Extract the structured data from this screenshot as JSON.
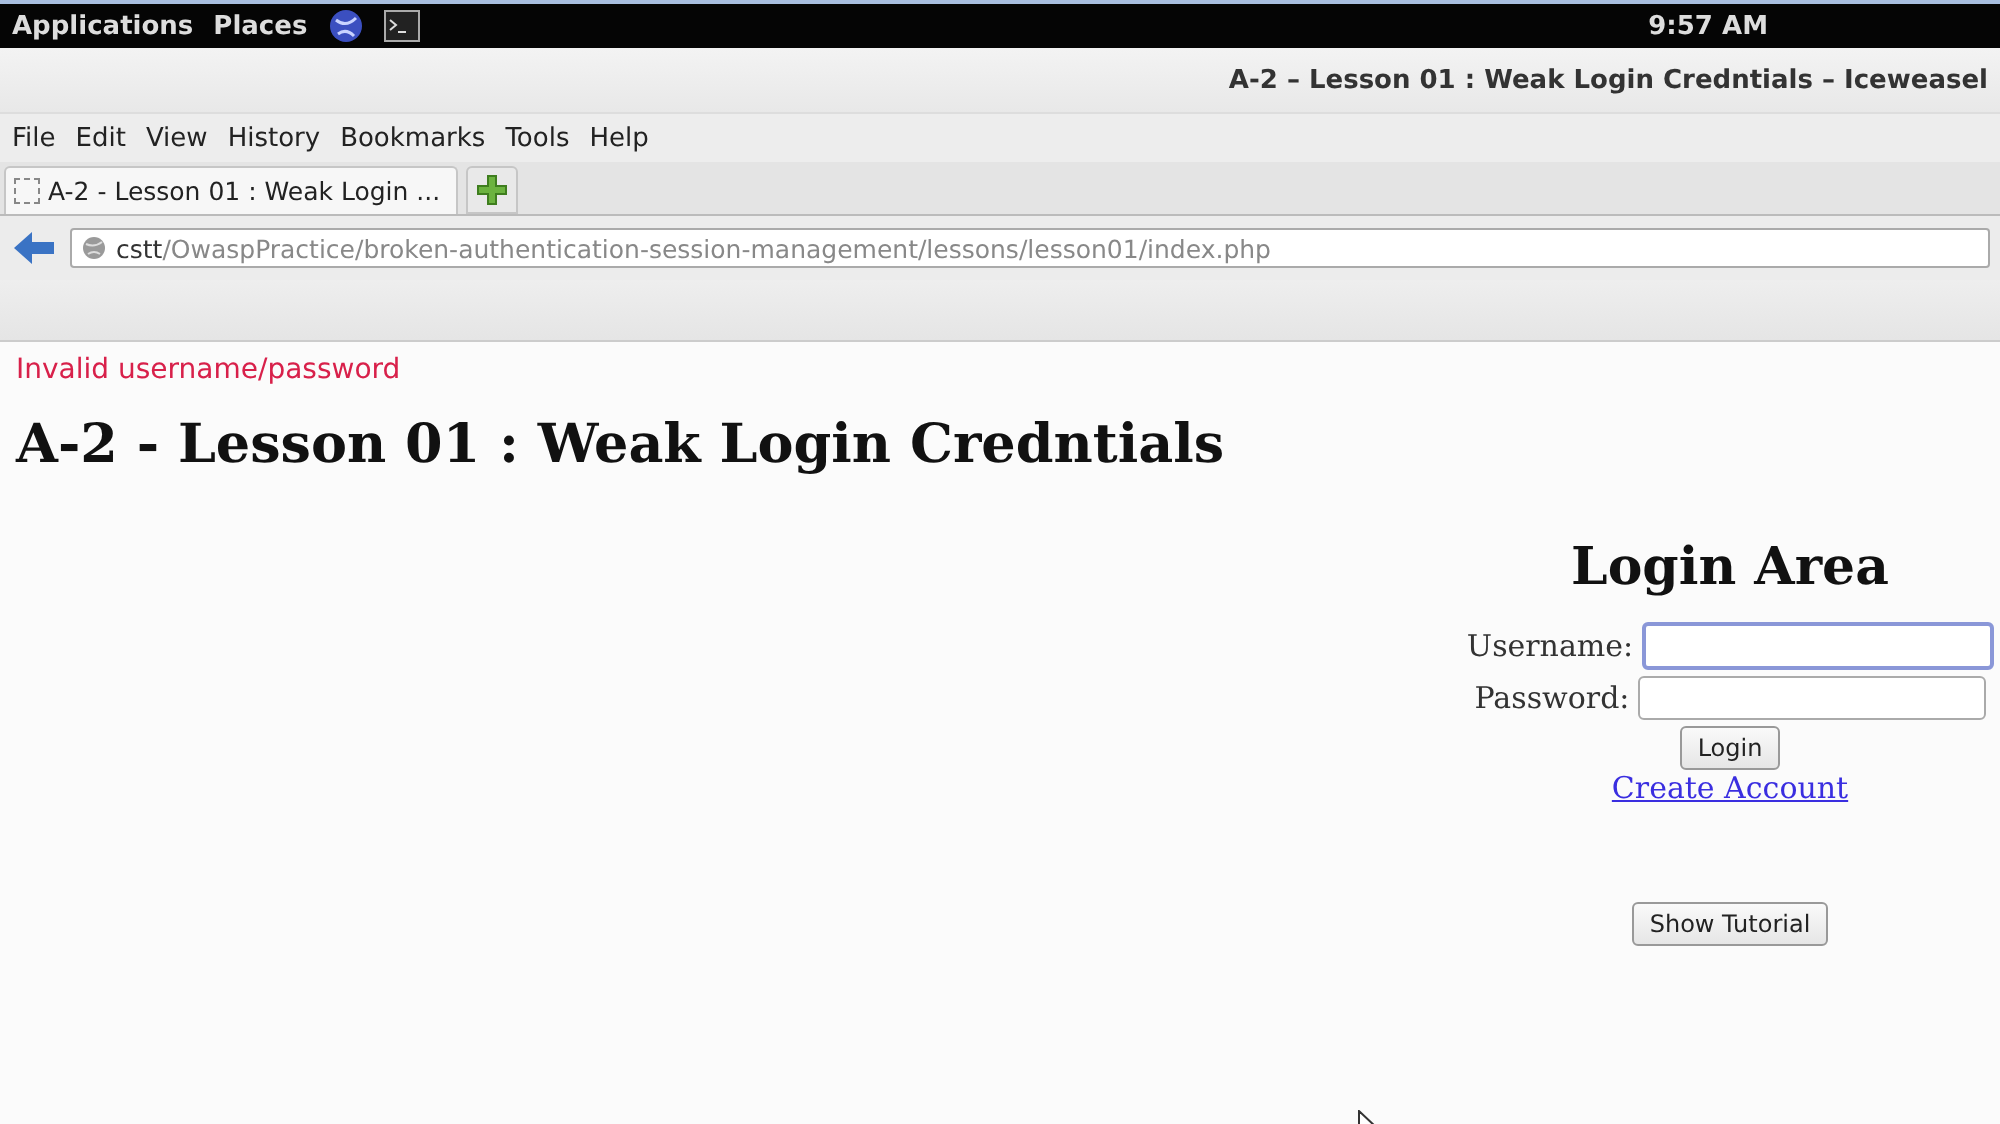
{
  "top_panel": {
    "menus": [
      "Applications",
      "Places"
    ],
    "clock": "9:57 AM"
  },
  "window": {
    "title": "A-2 – Lesson 01 : Weak Login Credntials – Iceweasel"
  },
  "menu_bar": [
    "File",
    "Edit",
    "View",
    "History",
    "Bookmarks",
    "Tools",
    "Help"
  ],
  "tabs": [
    {
      "label": "A-2 - Lesson 01 : Weak Login ...",
      "selected": true
    }
  ],
  "address_bar": {
    "host": "cstt",
    "path": "/OwaspPractice/broken-authentication-session-management/lessons/lesson01/index.php"
  },
  "page": {
    "error": "Invalid username/password",
    "heading": "A-2 - Lesson 01 : Weak Login Credntials",
    "login": {
      "title": "Login Area",
      "fields": [
        {
          "label": "Username:",
          "focused": true
        },
        {
          "label": "Password:",
          "focused": false
        }
      ],
      "submit": "Login",
      "link": "Create Account"
    },
    "tutorial_button": "Show Tutorial"
  }
}
